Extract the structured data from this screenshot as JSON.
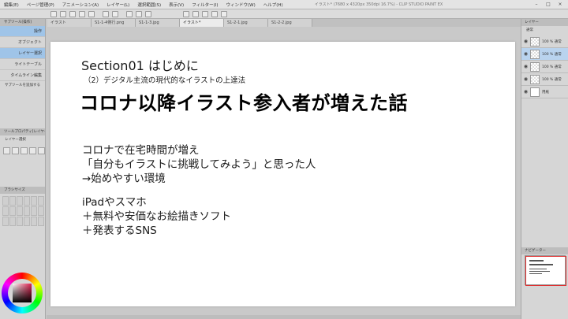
{
  "window": {
    "title": "イラスト* (7680 x 4320px 350dpi 16.7%) - CLIP STUDIO PAINT EX"
  },
  "menu": [
    "編集(E)",
    "ページ管理(P)",
    "アニメーション(A)",
    "レイヤー(L)",
    "選択範囲(S)",
    "表示(V)",
    "フィルター(I)",
    "ウィンドウ(W)",
    "ヘルプ(H)"
  ],
  "tabs": [
    {
      "label": "イラスト",
      "active": false
    },
    {
      "label": "S1-1-4例行.png",
      "active": false
    },
    {
      "label": "S1-1-3.jpg",
      "active": false
    },
    {
      "label": "イラスト*",
      "active": true
    },
    {
      "label": "S1-2-1.jpg",
      "active": false
    },
    {
      "label": "S1-2-2.jpg",
      "active": false
    }
  ],
  "left_panel": {
    "header": "サブツール[操作]",
    "tool_rows": [
      {
        "label": "操作",
        "selected": true
      },
      {
        "label": "オブジェクト",
        "selected": false
      },
      {
        "label": "レイヤー選択",
        "selected": true
      },
      {
        "label": "ライトテーブル",
        "selected": false
      },
      {
        "label": "タイムライン編集",
        "selected": false
      }
    ],
    "add_subtool": "サブツールを追加する",
    "tool_property_header": "ツールプロパティ[レイヤー選択]",
    "tool_property_item": "レイヤー選択",
    "brush_header": "ブラシサイズ"
  },
  "slide": {
    "section": "Section01 はじめに",
    "subheading": "（2）デジタル主流の現代的なイラストの上達法",
    "headline": "コロナ以降イラスト参入者が増えた話",
    "body": [
      "コロナで在宅時間が増え",
      "「自分もイラストに挑戦してみよう」と思った人",
      "→始めやすい環境",
      "",
      "iPadやスマホ",
      "＋無料や安価なお絵描きソフト",
      "＋発表するSNS"
    ]
  },
  "right_panel": {
    "layer_header": "レイヤー",
    "blend_mode": "通常",
    "layers": [
      {
        "label": "100 % 通常",
        "selected": false
      },
      {
        "label": "100 % 通常",
        "selected": true
      },
      {
        "label": "100 % 通常",
        "selected": false
      },
      {
        "label": "100 % 通常",
        "selected": false
      },
      {
        "label": "用紙",
        "selected": false
      }
    ],
    "navigator_header": "ナビゲーター"
  }
}
